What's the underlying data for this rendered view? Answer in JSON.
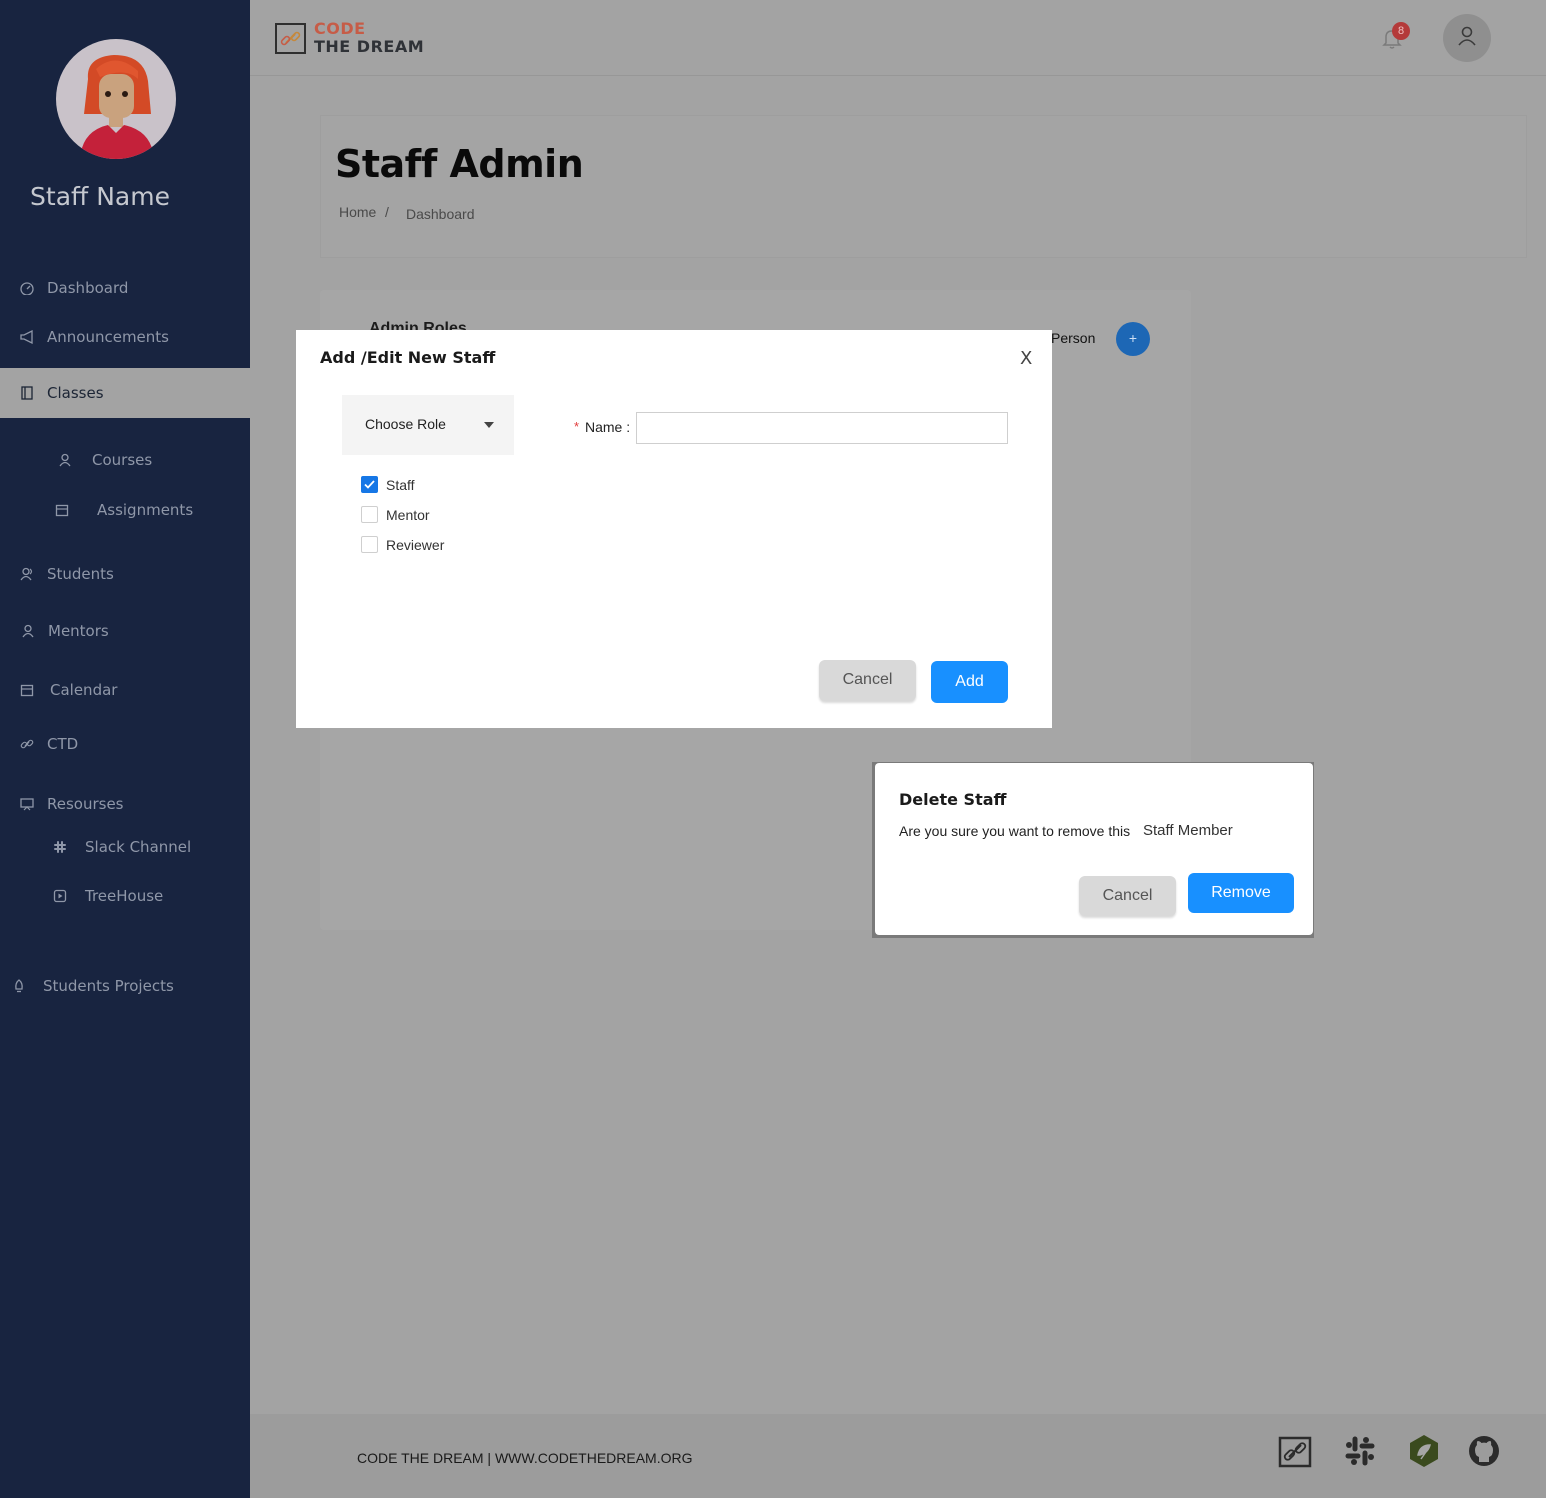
{
  "sidebar": {
    "user_name": "Staff Name",
    "items": [
      {
        "label": "Dashboard",
        "icon": "dashboard-icon"
      },
      {
        "label": "Announcements",
        "icon": "megaphone-icon"
      },
      {
        "label": "Classes",
        "icon": "book-icon"
      },
      {
        "label": "Courses",
        "icon": "user-icon"
      },
      {
        "label": "Assignments",
        "icon": "calendar-icon"
      },
      {
        "label": "Students",
        "icon": "users-icon"
      },
      {
        "label": "Mentors",
        "icon": "user-icon"
      },
      {
        "label": "Calendar",
        "icon": "calendar-icon"
      },
      {
        "label": "CTD",
        "icon": "link-icon"
      },
      {
        "label": "Resourses",
        "icon": "presentation-icon"
      },
      {
        "label": "Slack Channel",
        "icon": "slack-icon"
      },
      {
        "label": "TreeHouse",
        "icon": "play-icon"
      },
      {
        "label": "Students Projects",
        "icon": "rocket-icon"
      }
    ],
    "active_item": "Classes"
  },
  "header": {
    "logo_line1": "CODE",
    "logo_line2": "THE DREAM",
    "notification_count": "8"
  },
  "page": {
    "title": "Staff Admin",
    "breadcrumb": {
      "home": "Home",
      "separator": "/",
      "current": "Dashboard"
    }
  },
  "background_card": {
    "title": "Admin Roles",
    "person_label": "Person",
    "add_button": "+"
  },
  "add_modal": {
    "title": "Add /Edit New Staff",
    "close": "X",
    "role_select": "Choose Role",
    "roles": [
      {
        "label": "Staff",
        "checked": true
      },
      {
        "label": "Mentor",
        "checked": false
      },
      {
        "label": "Reviewer",
        "checked": false
      }
    ],
    "name_required": "*",
    "name_label": "Name :",
    "name_value": "",
    "cancel": "Cancel",
    "add": "Add"
  },
  "delete_dialog": {
    "title": "Delete Staff",
    "message": "Are you sure you want to remove this",
    "target": "Staff Member",
    "cancel": "Cancel",
    "remove": "Remove"
  },
  "footer": {
    "text": "CODE THE DREAM | WWW.CODETHEDREAM.ORG",
    "icons": [
      "code-the-dream-icon",
      "slack-icon",
      "treehouse-icon",
      "github-icon"
    ]
  },
  "colors": {
    "sidebar_bg": "#182440",
    "primary_blue": "#1890ff",
    "overlay_gray": "#a3a3a3",
    "logo_accent": "#c65c47"
  }
}
